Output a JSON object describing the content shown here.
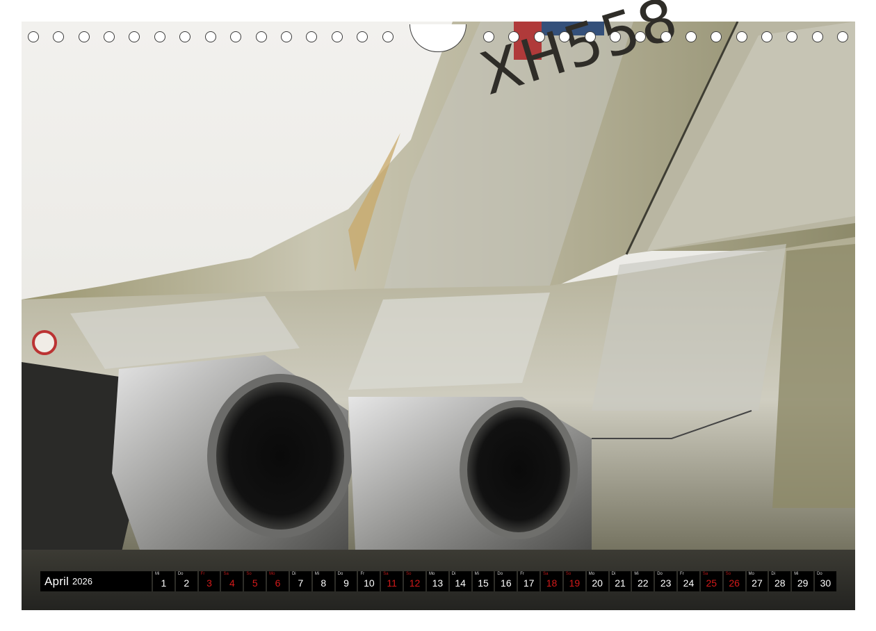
{
  "photo": {
    "subject": "Avro Vulcan bomber tail and jet exhausts",
    "tail_code": "XH558"
  },
  "calendar": {
    "month": "April",
    "year": "2026",
    "days": [
      {
        "wd": "Mi",
        "num": "1",
        "holiday": false
      },
      {
        "wd": "Do",
        "num": "2",
        "holiday": false
      },
      {
        "wd": "Fr",
        "num": "3",
        "holiday": true
      },
      {
        "wd": "Sa",
        "num": "4",
        "holiday": true
      },
      {
        "wd": "So",
        "num": "5",
        "holiday": true
      },
      {
        "wd": "Mo",
        "num": "6",
        "holiday": true
      },
      {
        "wd": "Di",
        "num": "7",
        "holiday": false
      },
      {
        "wd": "Mi",
        "num": "8",
        "holiday": false
      },
      {
        "wd": "Do",
        "num": "9",
        "holiday": false
      },
      {
        "wd": "Fr",
        "num": "10",
        "holiday": false
      },
      {
        "wd": "Sa",
        "num": "11",
        "holiday": true
      },
      {
        "wd": "So",
        "num": "12",
        "holiday": true
      },
      {
        "wd": "Mo",
        "num": "13",
        "holiday": false
      },
      {
        "wd": "Di",
        "num": "14",
        "holiday": false
      },
      {
        "wd": "Mi",
        "num": "15",
        "holiday": false
      },
      {
        "wd": "Do",
        "num": "16",
        "holiday": false
      },
      {
        "wd": "Fr",
        "num": "17",
        "holiday": false
      },
      {
        "wd": "Sa",
        "num": "18",
        "holiday": true
      },
      {
        "wd": "So",
        "num": "19",
        "holiday": true
      },
      {
        "wd": "Mo",
        "num": "20",
        "holiday": false
      },
      {
        "wd": "Di",
        "num": "21",
        "holiday": false
      },
      {
        "wd": "Mi",
        "num": "22",
        "holiday": false
      },
      {
        "wd": "Do",
        "num": "23",
        "holiday": false
      },
      {
        "wd": "Fr",
        "num": "24",
        "holiday": false
      },
      {
        "wd": "Sa",
        "num": "25",
        "holiday": true
      },
      {
        "wd": "So",
        "num": "26",
        "holiday": true
      },
      {
        "wd": "Mo",
        "num": "27",
        "holiday": false
      },
      {
        "wd": "Di",
        "num": "28",
        "holiday": false
      },
      {
        "wd": "Mi",
        "num": "29",
        "holiday": false
      },
      {
        "wd": "Do",
        "num": "30",
        "holiday": false
      }
    ]
  }
}
